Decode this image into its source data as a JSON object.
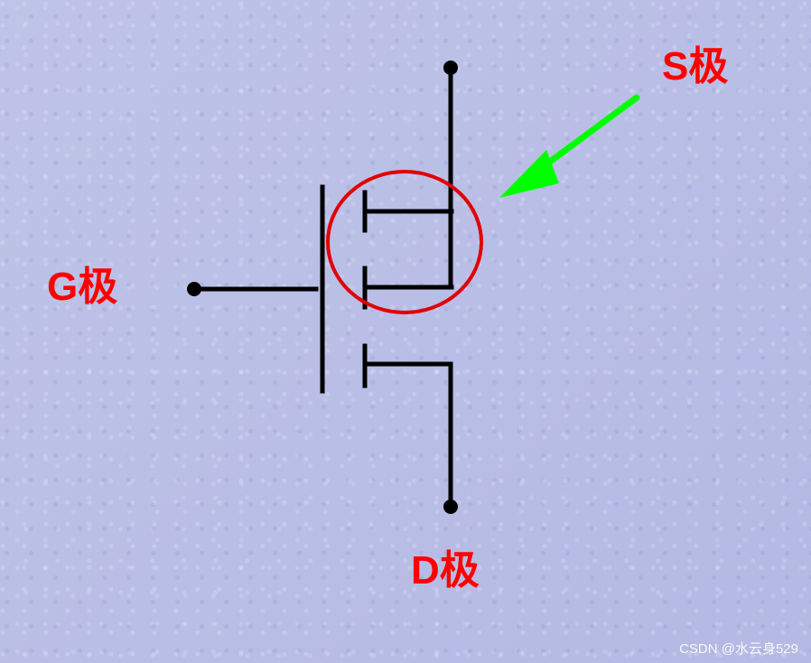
{
  "labels": {
    "source": "S极",
    "gate": "G极",
    "drain": "D极"
  },
  "watermark": "CSDN @水云身529",
  "colors": {
    "background": "#b9bee6",
    "label": "#ff0000",
    "circuit": "#000000",
    "highlight_circle": "#e10000",
    "arrow": "#00ff00"
  }
}
